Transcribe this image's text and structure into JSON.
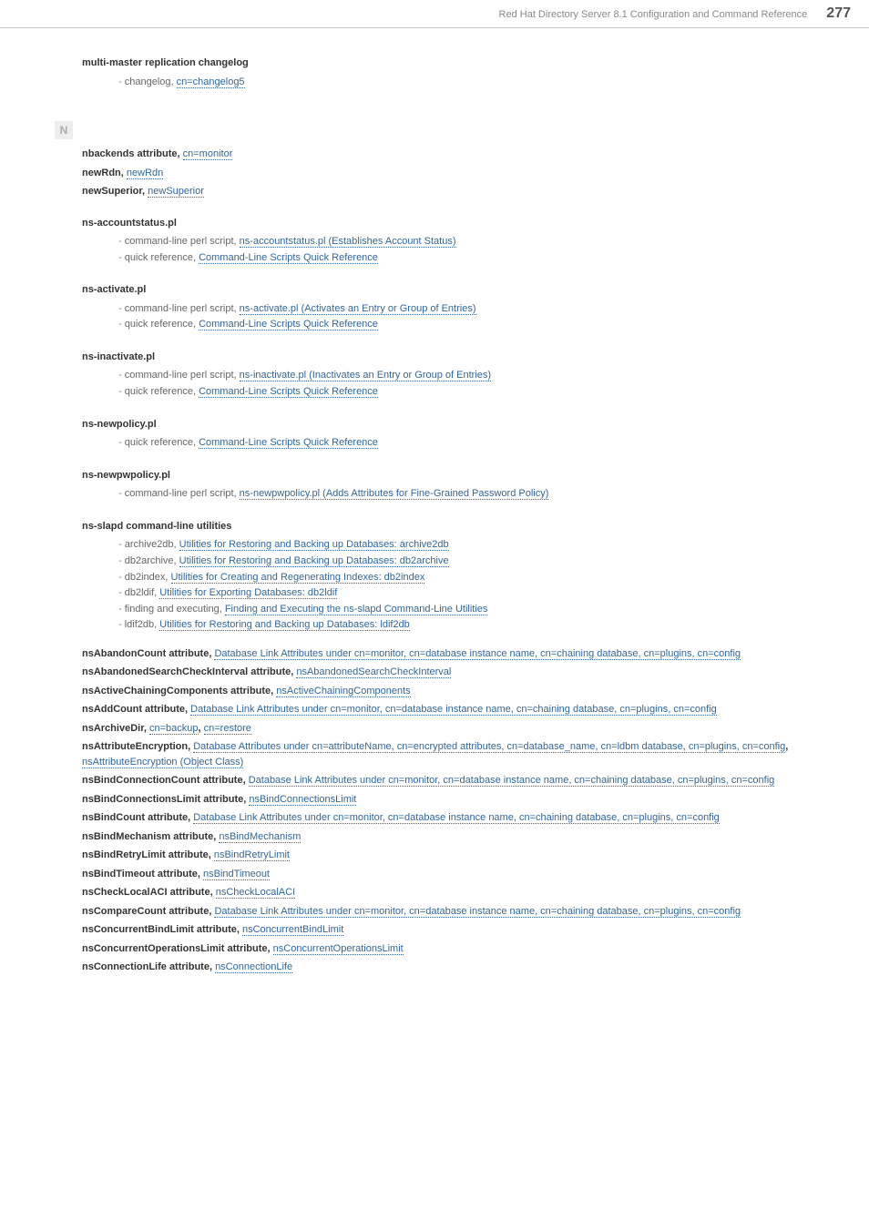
{
  "header": {
    "crumb": "Red Hat Directory Server 8.1 Configuration and Command Reference",
    "page": "277"
  },
  "pre_entries": [
    {
      "title": "multi-master replication changelog",
      "subs": [
        {
          "text": "changelog, ",
          "link": "cn=changelog5"
        }
      ]
    }
  ],
  "letter": "N",
  "entries": [
    {
      "title": "nbackends attribute, ",
      "link": "cn=monitor"
    },
    {
      "title": "newRdn, ",
      "link": "newRdn"
    },
    {
      "title": "newSuperior, ",
      "link": "newSuperior"
    },
    {
      "title": "ns-accountstatus.pl",
      "subs": [
        {
          "text": "command-line perl script, ",
          "link": "ns-accountstatus.pl (Establishes Account Status)"
        },
        {
          "text": "quick reference, ",
          "link": "Command-Line Scripts Quick Reference"
        }
      ]
    },
    {
      "title": "ns-activate.pl",
      "subs": [
        {
          "text": "command-line perl script, ",
          "link": "ns-activate.pl (Activates an Entry or Group of Entries)"
        },
        {
          "text": "quick reference, ",
          "link": "Command-Line Scripts Quick Reference"
        }
      ]
    },
    {
      "title": "ns-inactivate.pl",
      "subs": [
        {
          "text": "command-line perl script, ",
          "link": "ns-inactivate.pl (Inactivates an Entry or Group of Entries)"
        },
        {
          "text": "quick reference, ",
          "link": "Command-Line Scripts Quick Reference"
        }
      ]
    },
    {
      "title": "ns-newpolicy.pl",
      "subs": [
        {
          "text": "quick reference, ",
          "link": "Command-Line Scripts Quick Reference"
        }
      ]
    },
    {
      "title": "ns-newpwpolicy.pl",
      "subs": [
        {
          "text": "command-line perl script, ",
          "link": "ns-newpwpolicy.pl (Adds Attributes for Fine-Grained Password Policy)"
        }
      ]
    },
    {
      "title": "ns-slapd command-line utilities",
      "subs": [
        {
          "text": "archive2db, ",
          "link": "Utilities for Restoring and Backing up Databases: archive2db"
        },
        {
          "text": "db2archive, ",
          "link": "Utilities for Restoring and Backing up Databases: db2archive"
        },
        {
          "text": "db2index, ",
          "link": "Utilities for Creating and Regenerating Indexes: db2index"
        },
        {
          "text": "db2ldif, ",
          "link": "Utilities for Exporting Databases: db2ldif"
        },
        {
          "text": "finding and executing, ",
          "link": "Finding and Executing the ns-slapd Command-Line Utilities"
        },
        {
          "text": "ldif2db, ",
          "link": "Utilities for Restoring and Backing up Databases: ldif2db"
        }
      ]
    },
    {
      "title": "nsAbandonCount attribute, ",
      "link": "Database Link Attributes under cn=monitor, cn=database instance name, cn=chaining database, cn=plugins, cn=config"
    },
    {
      "title": "nsAbandonedSearchCheckInterval attribute, ",
      "link": "nsAbandonedSearchCheckInterval"
    },
    {
      "title": "nsActiveChainingComponents attribute, ",
      "link": "nsActiveChainingComponents"
    },
    {
      "title": "nsAddCount attribute, ",
      "link": "Database Link Attributes under cn=monitor, cn=database instance name, cn=chaining database, cn=plugins, cn=config"
    },
    {
      "title": "nsArchiveDir, ",
      "link": "cn=backup",
      "sep": ", ",
      "link2": "cn=restore"
    },
    {
      "title": "nsAttributeEncryption, ",
      "link": "Database Attributes under cn=attributeName, cn=encrypted attributes, cn=database_name, cn=ldbm database, cn=plugins, cn=config",
      "sep": ", ",
      "link2": "nsAttributeEncryption (Object Class)"
    },
    {
      "title": "nsBindConnectionCount attribute, ",
      "link": "Database Link Attributes under cn=monitor, cn=database instance name, cn=chaining database, cn=plugins, cn=config"
    },
    {
      "title": "nsBindConnectionsLimit attribute, ",
      "link": "nsBindConnectionsLimit"
    },
    {
      "title": "nsBindCount attribute, ",
      "link": "Database Link Attributes under cn=monitor, cn=database instance name, cn=chaining database, cn=plugins, cn=config"
    },
    {
      "title": "nsBindMechanism attribute, ",
      "link": "nsBindMechanism"
    },
    {
      "title": "nsBindRetryLimit attribute, ",
      "link": "nsBindRetryLimit"
    },
    {
      "title": "nsBindTimeout attribute, ",
      "link": "nsBindTimeout"
    },
    {
      "title": "nsCheckLocalACI attribute, ",
      "link": "nsCheckLocalACI"
    },
    {
      "title": "nsCompareCount attribute, ",
      "link": "Database Link Attributes under cn=monitor, cn=database instance name, cn=chaining database, cn=plugins, cn=config"
    },
    {
      "title": "nsConcurrentBindLimit attribute, ",
      "link": "nsConcurrentBindLimit"
    },
    {
      "title": "nsConcurrentOperationsLimit attribute, ",
      "link": "nsConcurrentOperationsLimit"
    },
    {
      "title": "nsConnectionLife attribute, ",
      "link": "nsConnectionLife"
    }
  ]
}
